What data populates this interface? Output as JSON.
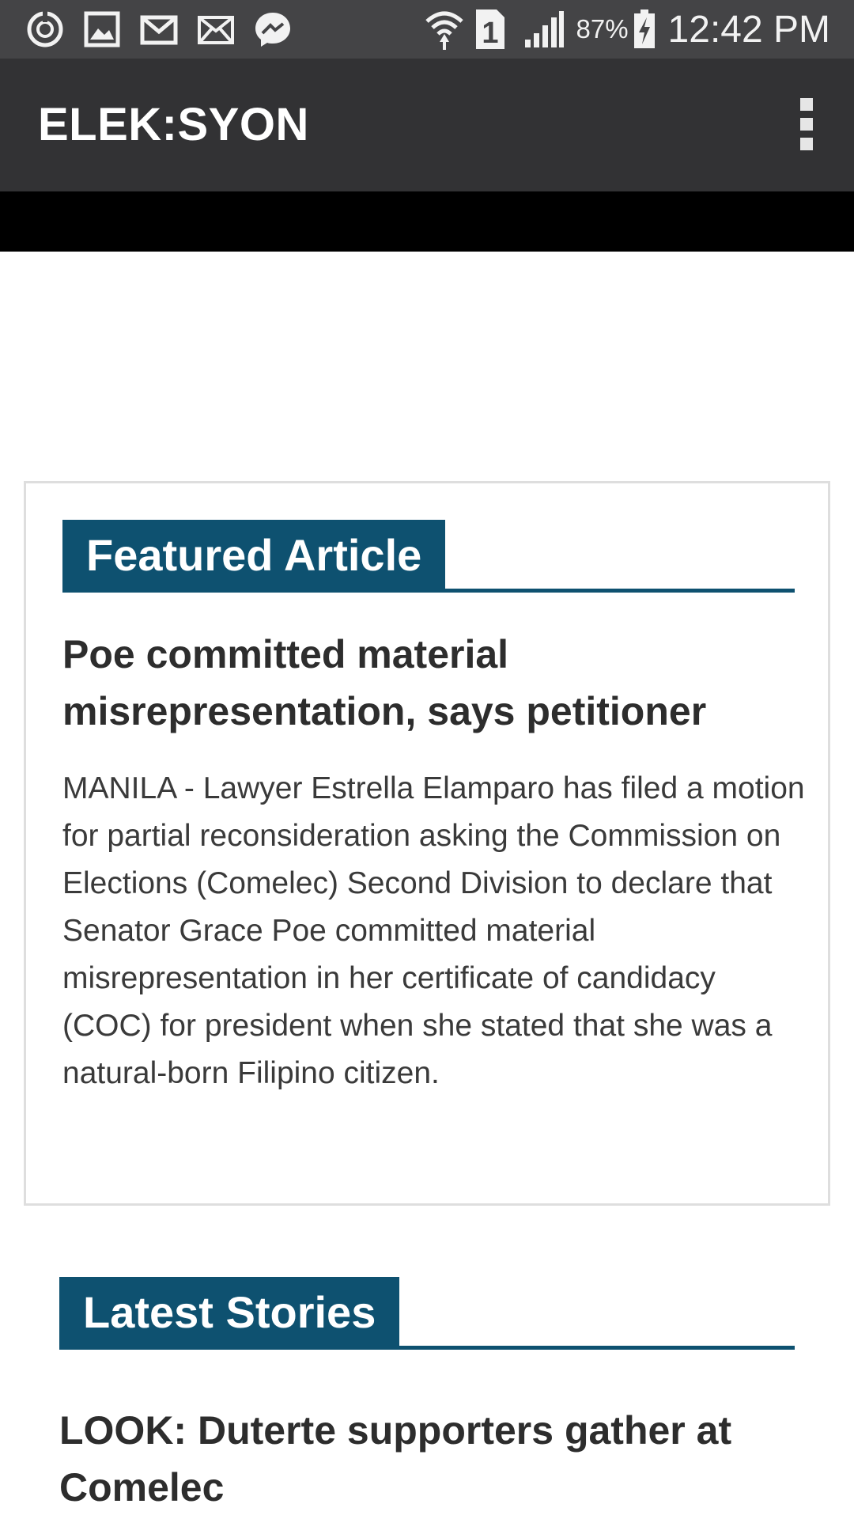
{
  "status_bar": {
    "icons_left": [
      "sync-icon",
      "gallery-icon",
      "gmail-icon",
      "mail-icon",
      "messenger-icon"
    ],
    "icons_right": [
      "wifi-icon",
      "sim-1-icon",
      "signal-icon"
    ],
    "battery_percent": "87%",
    "time": "12:42 PM",
    "icon_color": "#f2f2f2"
  },
  "app_bar": {
    "title": "ELEK:SYON",
    "menu_icon": "overflow-menu-icon",
    "background": "#323234"
  },
  "featured": {
    "section_label": "Featured Article",
    "accent": "#0e5170",
    "article_title": "Poe committed material misrepresentation, says petitioner",
    "article_body": "MANILA - Lawyer Estrella Elamparo has filed a motion for partial reconsideration asking the Commission on Elections (Comelec) Second Division to declare that Senator Grace Poe committed material misrepresentation in her certificate of candidacy (COC) for president when she stated that she was a natural-born Filipino citizen."
  },
  "latest": {
    "section_label": "Latest Stories",
    "stories": [
      {
        "title": "LOOK: Duterte supporters gather at Comelec"
      }
    ]
  }
}
